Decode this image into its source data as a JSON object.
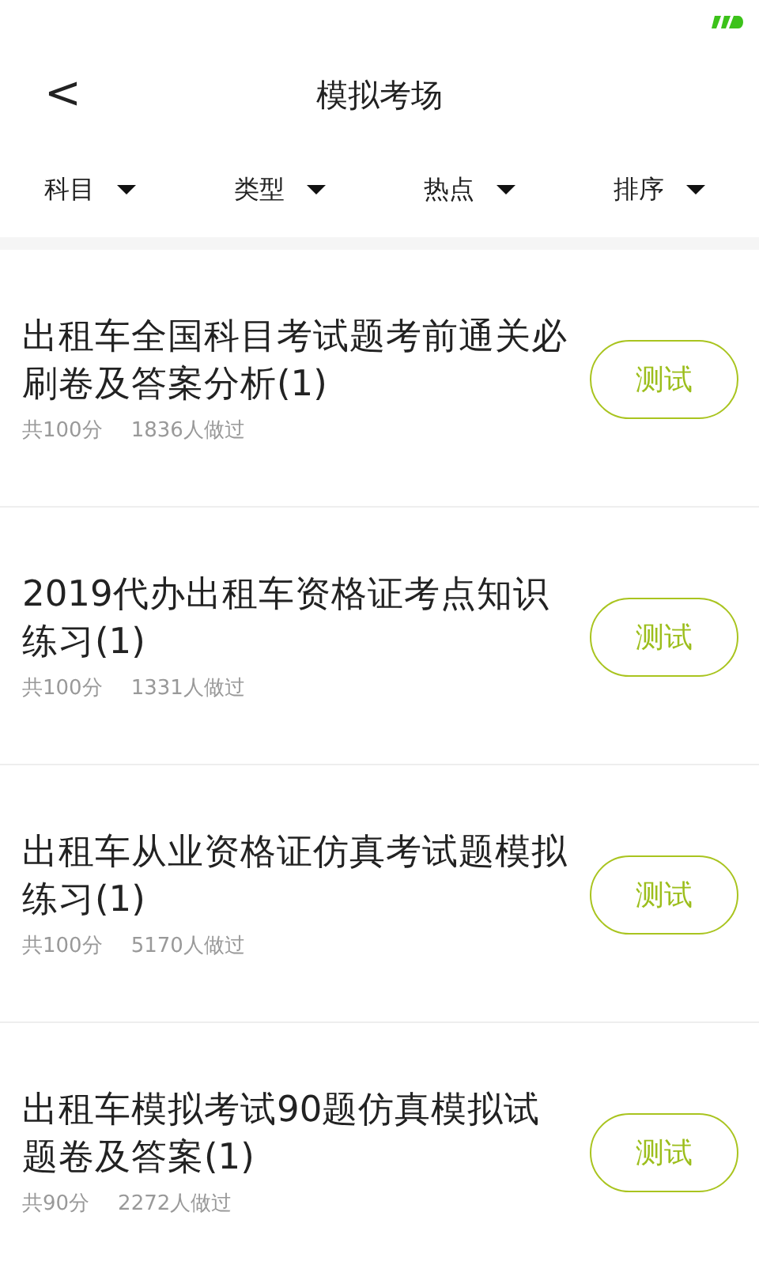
{
  "header": {
    "back": "<",
    "title": "模拟考场"
  },
  "filters": [
    {
      "label": "科目"
    },
    {
      "label": "类型"
    },
    {
      "label": "热点"
    },
    {
      "label": "排序"
    }
  ],
  "exams": [
    {
      "title": "出租车全国科目考试题考前通关必刷卷及答案分析(1)",
      "score": "共100分",
      "takers": "1836人做过",
      "action": "测试"
    },
    {
      "title": "2019代办出租车资格证考点知识练习(1)",
      "score": "共100分",
      "takers": "1331人做过",
      "action": "测试"
    },
    {
      "title": "出租车从业资格证仿真考试题模拟练习(1)",
      "score": "共100分",
      "takers": "5170人做过",
      "action": "测试"
    },
    {
      "title": "出租车模拟考试90题仿真模拟试题卷及答案(1)",
      "score": "共90分",
      "takers": "2272人做过",
      "action": "测试"
    }
  ]
}
